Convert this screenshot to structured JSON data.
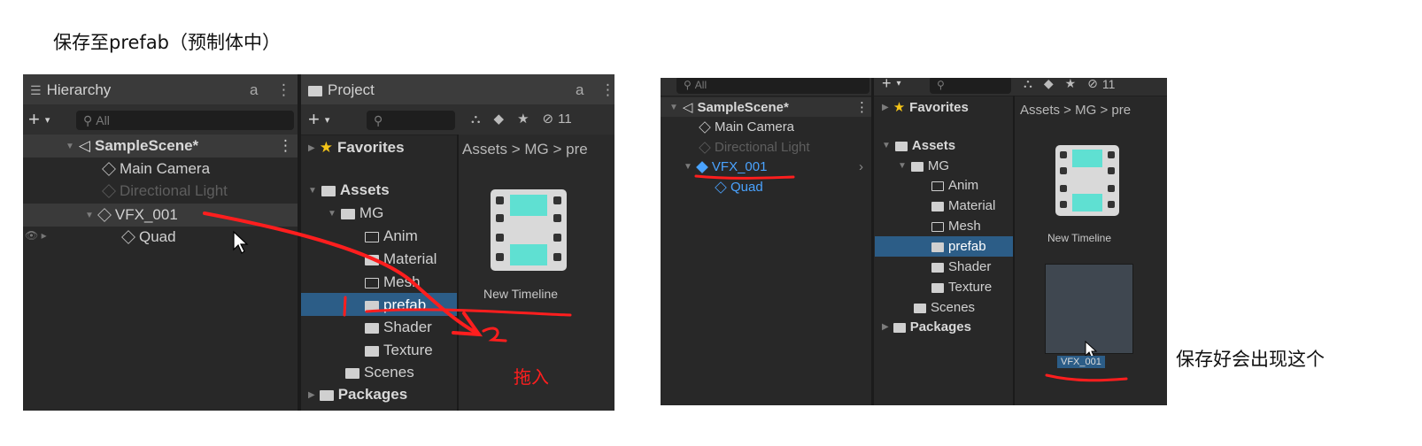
{
  "title": "保存至prefab（预制体中）",
  "right_caption": "保存好会出现这个",
  "left": {
    "hierarchy": {
      "tab_label": "Hierarchy",
      "search_placeholder": "All",
      "scene": "SampleScene*",
      "items": [
        "Main Camera",
        "Directional Light",
        "VFX_001",
        "Quad"
      ]
    },
    "project": {
      "tab_label": "Project",
      "favorites": "Favorites",
      "assets": "Assets",
      "mg": "MG",
      "folders": [
        "Anim",
        "Material",
        "Mesh",
        "prefab",
        "Shader",
        "Texture"
      ],
      "scenes": "Scenes",
      "packages": "Packages",
      "breadcrumb": "Assets > MG > pre",
      "asset_label": "New Timeline",
      "hidden_count": "11"
    },
    "annotation_num_1": "1",
    "annotation_num_2": "2",
    "annotation_drag": "拖入"
  },
  "right": {
    "search_placeholder": "All",
    "scene": "SampleScene*",
    "items": [
      "Main Camera",
      "Directional Light",
      "VFX_001",
      "Quad"
    ],
    "favorites": "Favorites",
    "assets": "Assets",
    "mg": "MG",
    "folders": [
      "Anim",
      "Material",
      "Mesh",
      "prefab",
      "Shader",
      "Texture"
    ],
    "scenes": "Scenes",
    "packages": "Packages",
    "breadcrumb": "Assets > MG > pre",
    "asset_label": "New Timeline",
    "prefab_label": "VFX_001",
    "hidden_count": "11"
  },
  "colors": {
    "annotation_red": "#ff1e1e",
    "selection_blue": "#2c5d87",
    "prefab_blue": "#4aa3ff",
    "timeline_teal": "#5fe0d2"
  }
}
